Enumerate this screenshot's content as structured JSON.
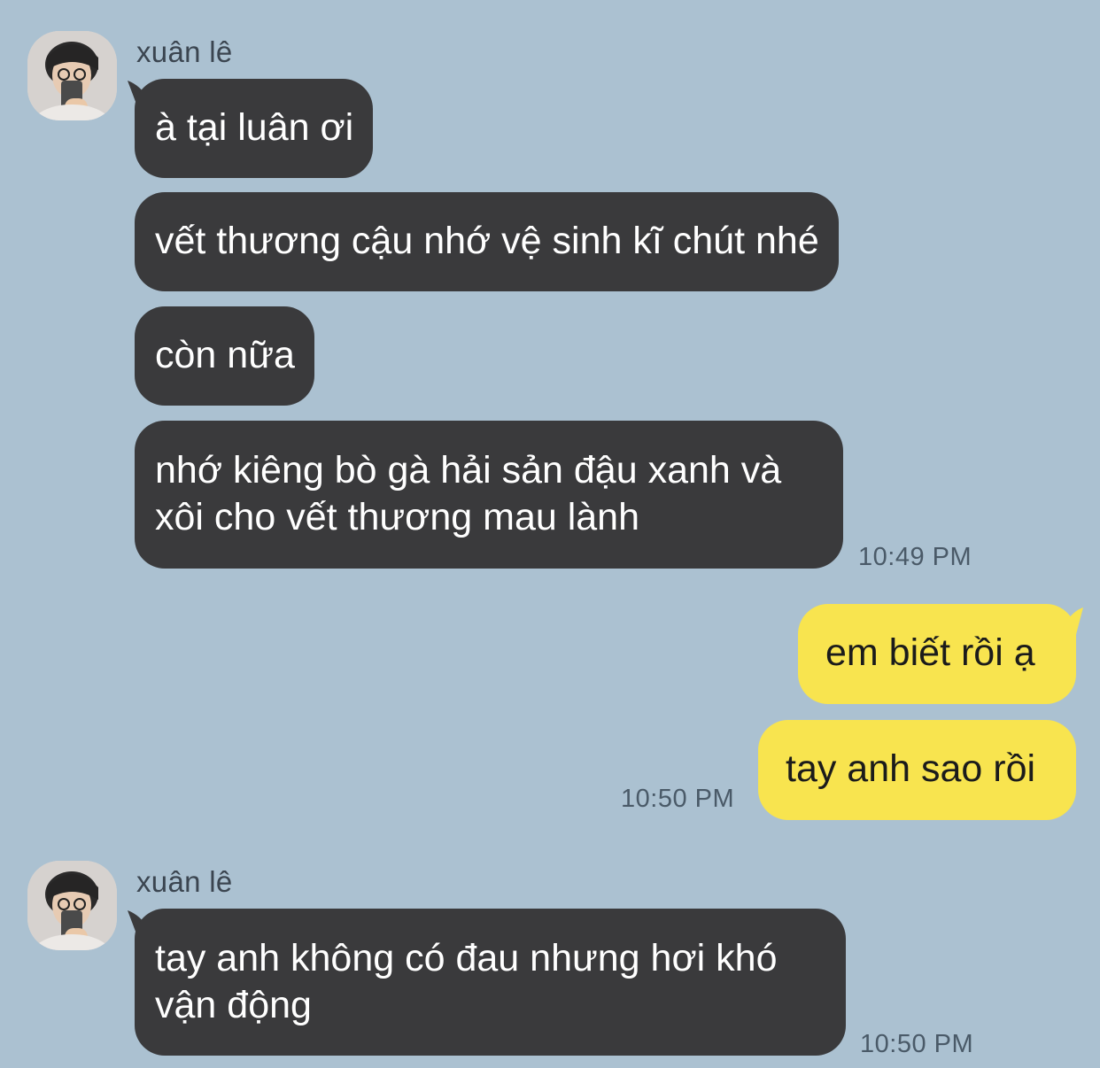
{
  "colors": {
    "background": "#abc1d1",
    "incoming_bubble": "#3a3a3c",
    "outgoing_bubble": "#f8e44f"
  },
  "messages": {
    "group1": {
      "sender": "xuân lê",
      "bubbles": [
        "à tại luân ơi",
        "vết thương cậu nhớ vệ sinh kĩ chút nhé",
        "còn nữa",
        "nhớ kiêng bò gà hải sản đậu xanh và xôi cho vết thương mau lành"
      ],
      "time": "10:49 PM"
    },
    "outgoing": {
      "bubbles": [
        "em biết rồi ạ",
        "tay anh sao rồi"
      ],
      "time": "10:50 PM"
    },
    "group2": {
      "sender": "xuân lê",
      "bubbles": [
        "tay anh không có đau nhưng hơi khó vận động"
      ],
      "time": "10:50 PM"
    }
  }
}
